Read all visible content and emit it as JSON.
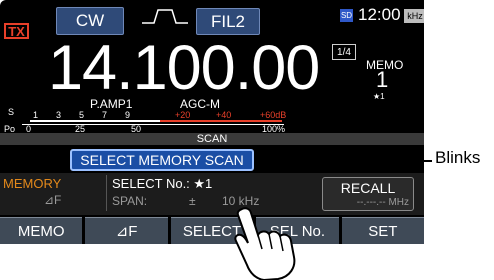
{
  "header": {
    "mode": "CW",
    "filter": "FIL2",
    "sd_badge": "SD",
    "time": "12:00",
    "khz_badge": "kHz",
    "tx": "TX",
    "frequency": "14.100.00",
    "fraction": "1/4",
    "memo_label": "MEMO",
    "memo_number": "1",
    "star": "★1"
  },
  "meter": {
    "labels": [
      "P.AMP1",
      "AGC-M"
    ],
    "s_scale": [
      "S",
      "1",
      "3",
      "5",
      "7",
      "9",
      "+20",
      "+40",
      "+60dB"
    ],
    "po_scale": [
      "Po",
      "0",
      "25",
      "50",
      "100%"
    ]
  },
  "scan": {
    "band_label": "SCAN",
    "button": "SELECT MEMORY SCAN"
  },
  "panel": {
    "memory": "MEMORY",
    "delta_f": "⊿F",
    "select_no": "SELECT No.: ★1",
    "span_label": "SPAN:",
    "span_pm": "±",
    "span_value": "10 kHz",
    "recall": "RECALL",
    "recall_value": "--.---.-- MHz"
  },
  "bottom": [
    "MEMO",
    "⊿F",
    "SELECT",
    "SEL No.",
    "SET"
  ],
  "annotation": "Blinks"
}
